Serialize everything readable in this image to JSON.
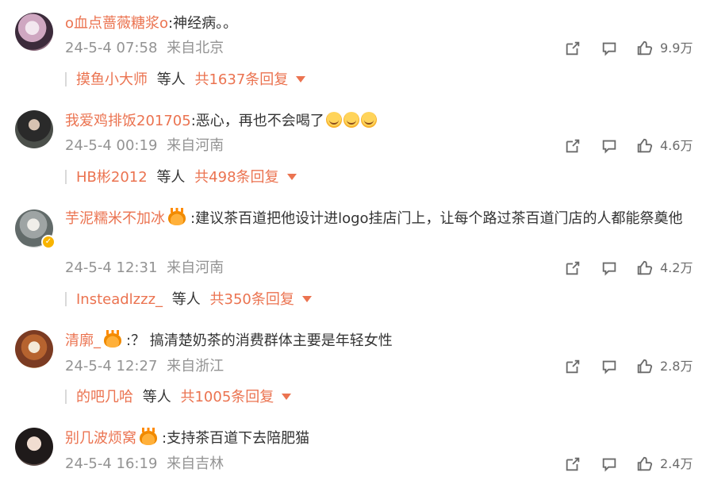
{
  "comments": [
    {
      "username": "o血点蔷薇糖浆o",
      "text": ":神经病。。",
      "date": "24-5-4 07:58",
      "location": "来自北京",
      "likes": "9.9万",
      "reply_user": "摸鱼小大师",
      "reply_label": "等人",
      "reply_count": "共1637条回复"
    },
    {
      "username": "我爱鸡排饭201705",
      "text": ":恶心，再也不会喝了",
      "date": "24-5-4 00:19",
      "location": "来自河南",
      "likes": "4.6万",
      "reply_user": "HB彬2012",
      "reply_label": "等人",
      "reply_count": "共498条回复"
    },
    {
      "username": "芋泥糯米不加冰",
      "text": ":建议茶百道把他设计进logo挂店门上，让每个路过茶百道门店的人都能祭奠他",
      "date": "24-5-4 12:31",
      "location": "来自河南",
      "likes": "4.2万",
      "reply_user": "Insteadlzzz_",
      "reply_label": "等人",
      "reply_count": "共350条回复"
    },
    {
      "username": "清廓_",
      "text": ":？ 搞清楚奶茶的消费群体主要是年轻女性",
      "date": "24-5-4 12:27",
      "location": "来自浙江",
      "likes": "2.8万",
      "reply_user": "的吧几哈",
      "reply_label": "等人",
      "reply_count": "共1005条回复"
    },
    {
      "username": "别几波烦窝",
      "text": ":支持茶百道下去陪肥猫",
      "date": "24-5-4 16:19",
      "location": "来自吉林",
      "likes": "2.4万"
    }
  ],
  "icons": {
    "share": "share-icon",
    "comment": "comment-icon",
    "like": "thumbs-up-icon"
  },
  "colors": {
    "username": "#eb7350",
    "meta": "#939393",
    "text": "#333333",
    "icon": "#6b6b6b"
  }
}
